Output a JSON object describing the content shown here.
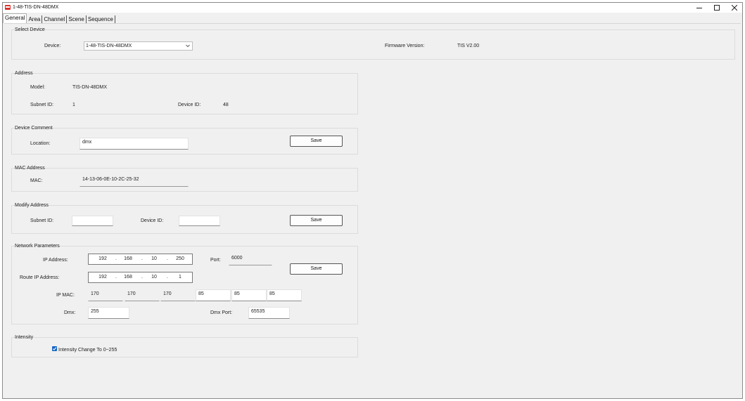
{
  "window": {
    "title": "1-48-TIS-DN-48DMX"
  },
  "tabs": [
    {
      "label": "General"
    },
    {
      "label": "Area"
    },
    {
      "label": "Channel"
    },
    {
      "label": "Scene"
    },
    {
      "label": "Sequence"
    }
  ],
  "select_device": {
    "title": "Select Device",
    "device_label": "Device:",
    "device_value": "1-48-TIS-DN-48DMX",
    "firmware_label": "Firmware Version:",
    "firmware_value": "TIS V2.00"
  },
  "address": {
    "title": "Address",
    "model_label": "Model:",
    "model_value": "TIS-DN-48DMX",
    "subnet_label": "Subnet ID:",
    "subnet_value": "1",
    "device_id_label": "Device ID:",
    "device_id_value": "48"
  },
  "device_comment": {
    "title": "Device Comment",
    "location_label": "Location:",
    "location_value": "dmx",
    "save_label": "Save"
  },
  "mac_address": {
    "title": "MAC Address",
    "mac_label": "MAC:",
    "mac_value": "14-13-06-0E-10-2C-25-32"
  },
  "modify_address": {
    "title": "Modify Address",
    "subnet_label": "Subnet ID:",
    "subnet_value": "",
    "device_id_label": "Device ID:",
    "device_id_value": "",
    "save_label": "Save"
  },
  "network": {
    "title": "Network Parameters",
    "ip_label": "IP Address:",
    "ip": [
      "192",
      "168",
      "10",
      "250"
    ],
    "port_label": "Port:",
    "port_value": "6000",
    "route_label": "Route IP Address:",
    "route_ip": [
      "192",
      "168",
      "10",
      "1"
    ],
    "ipmac_label": "IP MAC:",
    "ipmac": [
      "170",
      "170",
      "170",
      "85",
      "85",
      "85"
    ],
    "dmx_label": "Dmx:",
    "dmx_value": "255",
    "dmx_port_label": "Dmx Port:",
    "dmx_port_value": "65535",
    "save_label": "Save"
  },
  "intensity": {
    "title": "Intensity",
    "checkbox_label": "Intensity Change To 0~255",
    "checked": true
  },
  "colors": {
    "accent": "#1666c5",
    "icon_red": "#d9342b"
  }
}
